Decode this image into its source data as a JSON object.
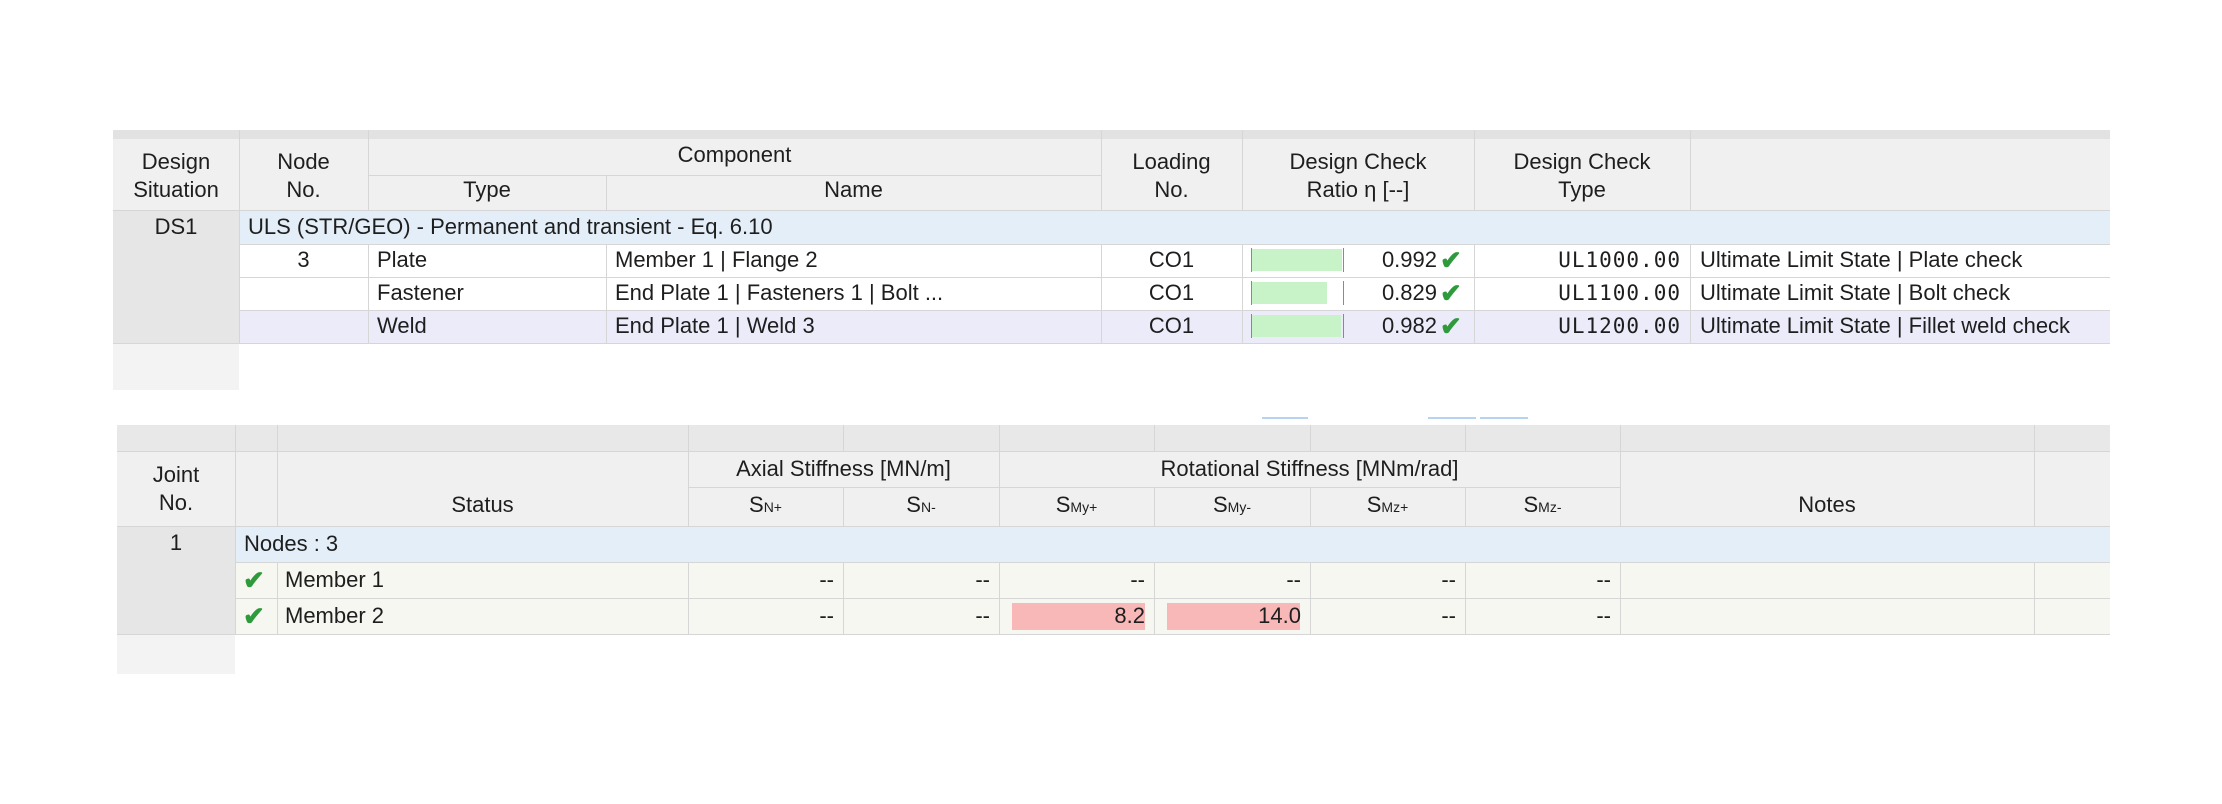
{
  "table1": {
    "headers": {
      "design_situation": [
        "Design",
        "Situation"
      ],
      "node_no": [
        "Node",
        "No."
      ],
      "component": "Component",
      "type": "Type",
      "name": "Name",
      "loading_no": [
        "Loading",
        "No."
      ],
      "design_check_ratio": [
        "Design Check",
        "Ratio η [--]"
      ],
      "design_check_type": [
        "Design Check",
        "Type"
      ]
    },
    "situation": "DS1",
    "group_label": "ULS (STR/GEO) - Permanent and transient - Eq. 6.10",
    "rows": [
      {
        "node": "3",
        "type": "Plate",
        "name": "Member 1 | Flange 2",
        "loading": "CO1",
        "ratio": 0.992,
        "ratio_text": "0.992",
        "check_type": "UL1000.00",
        "description": "Ultimate Limit State | Plate check"
      },
      {
        "node": "",
        "type": "Fastener",
        "name": "End Plate 1 | Fasteners 1 | Bolt ...",
        "loading": "CO1",
        "ratio": 0.829,
        "ratio_text": "0.829",
        "check_type": "UL1100.00",
        "description": "Ultimate Limit State | Bolt check"
      },
      {
        "node": "",
        "type": "Weld",
        "name": "End Plate 1 | Weld 3",
        "loading": "CO1",
        "ratio": 0.982,
        "ratio_text": "0.982",
        "check_type": "UL1200.00",
        "description": "Ultimate Limit State | Fillet weld check"
      }
    ]
  },
  "table2": {
    "headers": {
      "joint_no": [
        "Joint",
        "No."
      ],
      "status": "Status",
      "axial_group": "Axial Stiffness [MN/m]",
      "rotational_group": "Rotational Stiffness [MNm/rad]",
      "notes": "Notes",
      "sn_plus": {
        "main": "S",
        "sub": "N+"
      },
      "sn_minus": {
        "main": "S",
        "sub": "N-"
      },
      "smy_plus": {
        "main": "S",
        "sub": "My+"
      },
      "smy_minus": {
        "main": "S",
        "sub": "My-"
      },
      "smz_plus": {
        "main": "S",
        "sub": "Mz+"
      },
      "smz_minus": {
        "main": "S",
        "sub": "Mz-"
      }
    },
    "joint": "1",
    "group_label": "Nodes : 3",
    "rows": [
      {
        "member": "Member 1",
        "sn_plus": "--",
        "sn_minus": "--",
        "smy_plus": "--",
        "smy_minus": "--",
        "smz_plus": "--",
        "smz_minus": "--",
        "notes": ""
      },
      {
        "member": "Member 2",
        "sn_plus": "--",
        "sn_minus": "--",
        "smy_plus": "8.2",
        "smy_minus": "14.0",
        "smz_plus": "--",
        "smz_minus": "--",
        "notes": ""
      }
    ],
    "highlight_color": "#f8b8b8"
  },
  "colors": {
    "header_bg": "#f0f0f0",
    "group_row_bg": "#e4eef8",
    "selected_row_bg": "#ebebfa",
    "status_row_bg": "#f6f7f0",
    "left_col_bg": "#e6e6e6",
    "ratio_bar": "#c8f2c8",
    "check_green": "#2e9a3c"
  }
}
